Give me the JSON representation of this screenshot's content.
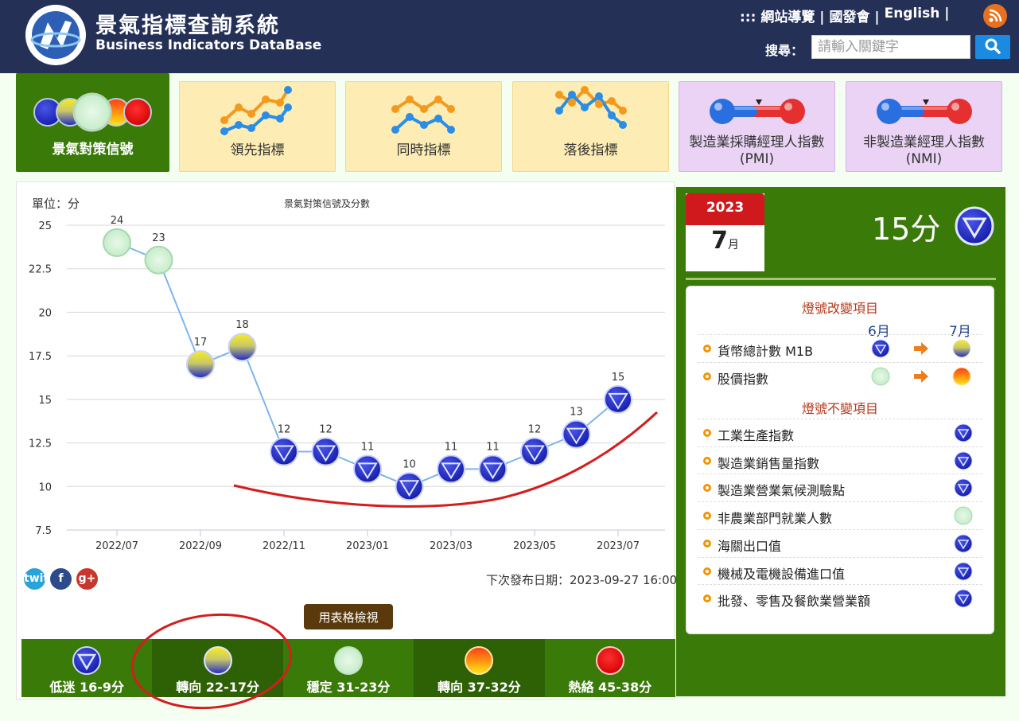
{
  "header": {
    "title": "景氣指標查詢系統",
    "subtitle": "Business Indicators DataBase",
    "nav": [
      "::: 網站導覽 |",
      "國發會 |",
      "English |"
    ],
    "search_label": "搜尋：",
    "search_placeholder": "請輸入關鍵字"
  },
  "tabs": [
    {
      "label": "景氣對策信號"
    },
    {
      "label": "領先指標"
    },
    {
      "label": "同時指標"
    },
    {
      "label": "落後指標"
    },
    {
      "label": "製造業採購經理人指數(PMI)"
    },
    {
      "label": "非製造業經理人指數(NMI)"
    }
  ],
  "chart_panel": {
    "unit": "單位：分",
    "next_release": "下次發布日期：2023-09-27 16:00",
    "table_button": "用表格檢視",
    "social": [
      "twitter",
      "f",
      "g+"
    ]
  },
  "chart_data": {
    "type": "line",
    "title": "景氣對策信號及分數",
    "ylabel": "單位：分",
    "ylim": [
      7.5,
      25
    ],
    "yticks": [
      7.5,
      10,
      12.5,
      15,
      17.5,
      20,
      22.5,
      25
    ],
    "x": [
      "2022/07",
      "2022/08",
      "2022/09",
      "2022/10",
      "2022/11",
      "2022/12",
      "2023/01",
      "2023/02",
      "2023/03",
      "2023/04",
      "2023/05",
      "2023/06",
      "2023/07"
    ],
    "xtick_labels": [
      "2022/07",
      "2022/09",
      "2022/11",
      "2023/01",
      "2023/03",
      "2023/05",
      "2023/07"
    ],
    "values": [
      24,
      23,
      17,
      18,
      12,
      12,
      11,
      10,
      11,
      11,
      12,
      13,
      15
    ],
    "signals": [
      "green",
      "green",
      "yellow-blue",
      "yellow-blue",
      "blue",
      "blue",
      "blue",
      "blue",
      "blue",
      "blue",
      "blue",
      "blue",
      "blue"
    ],
    "grid": true,
    "line_color": "#7cb5ec"
  },
  "legend": [
    {
      "label": "低迷 16-9分",
      "signal": "blue"
    },
    {
      "label": "轉向 22-17分",
      "signal": "yellow-blue"
    },
    {
      "label": "穩定 31-23分",
      "signal": "green"
    },
    {
      "label": "轉向 37-32分",
      "signal": "yellow-red"
    },
    {
      "label": "熱絡 45-38分",
      "signal": "red"
    }
  ],
  "summary": {
    "year": "2023",
    "month": "7",
    "month_suffix": "月",
    "score": "15分",
    "signal": "blue"
  },
  "changed_items": {
    "heading": "燈號改變項目",
    "col_prev": "6月",
    "col_curr": "7月",
    "rows": [
      {
        "name": "貨幣總計數 M1B",
        "prev": "blue",
        "curr": "yellow-blue"
      },
      {
        "name": "股價指數",
        "prev": "green",
        "curr": "yellow-red"
      }
    ]
  },
  "unchanged_items": {
    "heading": "燈號不變項目",
    "rows": [
      {
        "name": "工業生產指數",
        "signal": "blue"
      },
      {
        "name": "製造業銷售量指數",
        "signal": "blue"
      },
      {
        "name": "製造業營業氣候測驗點",
        "signal": "blue"
      },
      {
        "name": "非農業部門就業人數",
        "signal": "green"
      },
      {
        "name": "海關出口值",
        "signal": "blue"
      },
      {
        "name": "機械及電機設備進口值",
        "signal": "blue"
      },
      {
        "name": "批發、零售及餐飲業營業額",
        "signal": "blue"
      }
    ]
  },
  "colors": {
    "header_bg": "#253057",
    "green_panel": "#3a7a08",
    "legend_dark": "#2e6006",
    "annotation": "#d41e1e"
  }
}
